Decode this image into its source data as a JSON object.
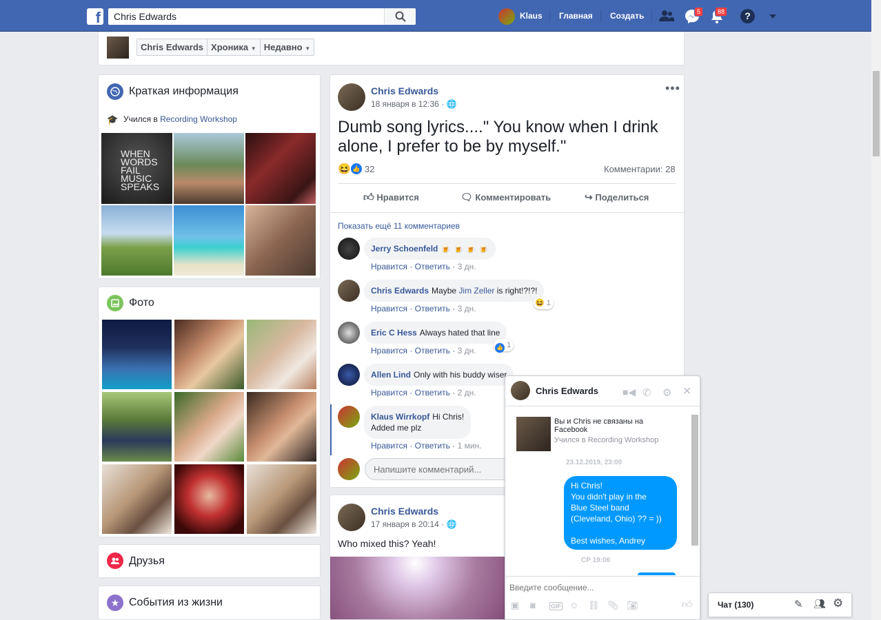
{
  "topbar": {
    "logo": "f",
    "search_value": "Chris Edwards",
    "user_name": "Klaus",
    "nav_home": "Главная",
    "nav_create": "Создать",
    "messages_badge": "5",
    "notifications_badge": "88",
    "help": "?"
  },
  "timeline_nav": {
    "name": "Chris Edwards",
    "timeline": "Хроника",
    "recent": "Недавно"
  },
  "intro": {
    "title": "Краткая информация",
    "studied_prefix": "Учился в",
    "studied_link": "Recording Workshop",
    "photo1_text": "WHEN WORDS FAIL MUSIC SPEAKS"
  },
  "photos": {
    "title": "Фото"
  },
  "friends": {
    "title": "Друзья"
  },
  "life_events": {
    "title": "События из жизни"
  },
  "post1": {
    "author": "Chris Edwards",
    "date": "18 января в 12:36",
    "text": "Dumb song lyrics....\" You know when I drink alone, I prefer to be by myself.\"",
    "reactions_count": "32",
    "comments_count": "Комментарии: 28",
    "like": "Нравится",
    "comment": "Комментировать",
    "share": "Поделиться",
    "more_comments": "Показать ещё 11 комментариев",
    "comments": [
      {
        "author": "Jerry Schoenfeld",
        "text": "🍺 🍺 🍺 🍺",
        "time": "3 дн.",
        "reaction": ""
      },
      {
        "author": "Chris Edwards",
        "text_pre": "Maybe",
        "mention": "Jim Zeller",
        "text_post": "is right!?!?!",
        "time": "3 дн.",
        "reaction": "1"
      },
      {
        "author": "Eric C Hess",
        "text": "Always hated that line",
        "time": "3 дн.",
        "reaction": "1"
      },
      {
        "author": "Allen Lind",
        "text": "Only with his buddy wiser",
        "time": "2 дн.",
        "reaction": ""
      },
      {
        "author": "Klaus Wirrkopf",
        "text": "Hi Chris!",
        "text2": "Added me plz",
        "time": "1 мин.",
        "reaction": ""
      }
    ],
    "like_label": "Нравится",
    "reply_label": "Ответить",
    "input_placeholder": "Напишите комментарий..."
  },
  "post2": {
    "author": "Chris Edwards",
    "date": "17 января в 20:14",
    "text": "Who mixed this? Yeah!"
  },
  "chat_window": {
    "name": "Chris Edwards",
    "not_connected": "Вы и Chris не связаны на Facebook",
    "studied": "Учился в Recording Workshop",
    "timestamp1": "23.12.2019, 23:00",
    "message": [
      "Hi Chris!",
      "You didn't play in the",
      "Blue Steel band",
      "(Cleveland, Ohio) ?? = ))",
      "",
      "Best wishes, Andrey"
    ],
    "timestamp2": "СР 19:06",
    "input_placeholder": "Введите сообщение..."
  },
  "chat_sidebar": {
    "label": "Чат (130)"
  },
  "colors": {
    "brand": "#4267b2",
    "link": "#385898",
    "messenger_blue": "#0099ff"
  }
}
